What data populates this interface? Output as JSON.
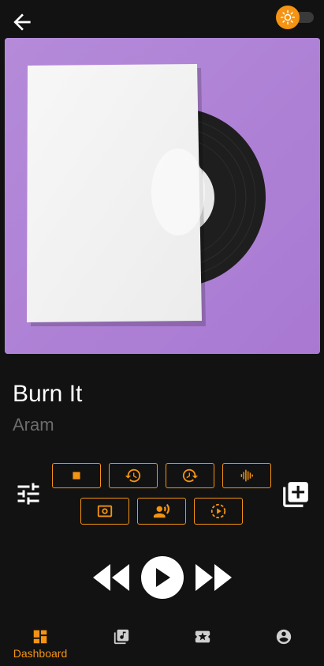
{
  "header": {
    "back_icon": "arrow-back-icon",
    "theme_toggle_icon": "sun-icon",
    "accent": "#f59312"
  },
  "track": {
    "title": "Burn It",
    "artist": "Aram"
  },
  "controls": {
    "row1": [
      "stop-icon",
      "replay-back-icon",
      "replay-forward-icon",
      "waveform-icon"
    ],
    "row2": [
      "surround-sound-icon",
      "voice-over-icon",
      "play-circle-dashed-icon"
    ],
    "left_icon": "tune-sliders-icon",
    "right_icon": "add-to-queue-icon"
  },
  "transport": [
    "rewind-icon",
    "play-icon",
    "fast-forward-icon"
  ],
  "nav": {
    "items": [
      {
        "label": "Dashboard",
        "icon": "dashboard-icon",
        "active": true
      },
      {
        "label": "",
        "icon": "music-library-icon",
        "active": false
      },
      {
        "label": "",
        "icon": "ticket-star-icon",
        "active": false
      },
      {
        "label": "",
        "icon": "account-icon",
        "active": false
      }
    ]
  }
}
